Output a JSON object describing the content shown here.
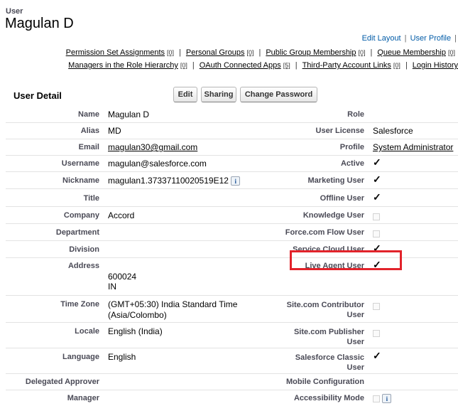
{
  "header": {
    "object_label": "User",
    "title": "Magulan D",
    "edit_layout": "Edit Layout",
    "user_profile": "User Profile",
    "separator": "|"
  },
  "related_links": {
    "row1": [
      {
        "label": "Permission Set Assignments",
        "count": "[0]"
      },
      {
        "label": "Personal Groups",
        "count": "[0]"
      },
      {
        "label": "Public Group Membership",
        "count": "[0]"
      },
      {
        "label": "Queue Membership",
        "count": "[0]"
      }
    ],
    "row2": [
      {
        "label": "Managers in the Role Hierarchy",
        "count": "[0]"
      },
      {
        "label": "OAuth Connected Apps",
        "count": "[5]"
      },
      {
        "label": "Third-Party Account Links",
        "count": "[0]"
      },
      {
        "label": "Login History",
        "count": ""
      }
    ]
  },
  "section": {
    "title": "User Detail",
    "buttons": {
      "edit": "Edit",
      "sharing": "Sharing",
      "change_password": "Change Password"
    }
  },
  "fields": {
    "name": {
      "label": "Name",
      "value": "Magulan D"
    },
    "alias": {
      "label": "Alias",
      "value": "MD"
    },
    "email": {
      "label": "Email",
      "value": "magulan30@gmail.com"
    },
    "username": {
      "label": "Username",
      "value": "magulan@salesforce.com"
    },
    "nickname": {
      "label": "Nickname",
      "value": "magulan1.37337110020519E12"
    },
    "title": {
      "label": "Title",
      "value": ""
    },
    "company": {
      "label": "Company",
      "value": "Accord"
    },
    "department": {
      "label": "Department",
      "value": ""
    },
    "division": {
      "label": "Division",
      "value": ""
    },
    "address": {
      "label": "Address",
      "line1": "600024",
      "line2": "IN"
    },
    "time_zone": {
      "label": "Time Zone",
      "line1": "(GMT+05:30) India Standard Time",
      "line2": "(Asia/Colombo)"
    },
    "locale": {
      "label": "Locale",
      "value": "English (India)"
    },
    "language": {
      "label": "Language",
      "value": "English"
    },
    "delegated_approver": {
      "label": "Delegated Approver",
      "value": ""
    },
    "manager": {
      "label": "Manager",
      "value": ""
    },
    "role": {
      "label": "Role",
      "value": ""
    },
    "user_license": {
      "label": "User License",
      "value": "Salesforce"
    },
    "profile": {
      "label": "Profile",
      "value": "System Administrator"
    },
    "active": {
      "label": "Active",
      "checked": true
    },
    "marketing_user": {
      "label": "Marketing User",
      "checked": true
    },
    "offline_user": {
      "label": "Offline User",
      "checked": true
    },
    "knowledge_user": {
      "label": "Knowledge User",
      "checked": false
    },
    "flow_user": {
      "label": "Force.com Flow User",
      "checked": false
    },
    "service_cloud_user": {
      "label": "Service Cloud User",
      "checked": true
    },
    "live_agent_user": {
      "label": "Live Agent User",
      "checked": true
    },
    "site_contributor_user": {
      "label1": "Site.com Contributor",
      "label2": "User",
      "checked": false
    },
    "site_publisher_user": {
      "label1": "Site.com Publisher",
      "label2": "User",
      "checked": false
    },
    "classic_user": {
      "label1": "Salesforce Classic",
      "label2": "User",
      "checked": true
    },
    "mobile_configuration": {
      "label": "Mobile Configuration",
      "value": ""
    },
    "accessibility_mode": {
      "label": "Accessibility Mode",
      "checked": false
    }
  },
  "glyphs": {
    "check": "✓",
    "info": "i"
  },
  "colors": {
    "link": "#015ba7",
    "highlight": "#e2232b",
    "label": "#4a4a56"
  }
}
